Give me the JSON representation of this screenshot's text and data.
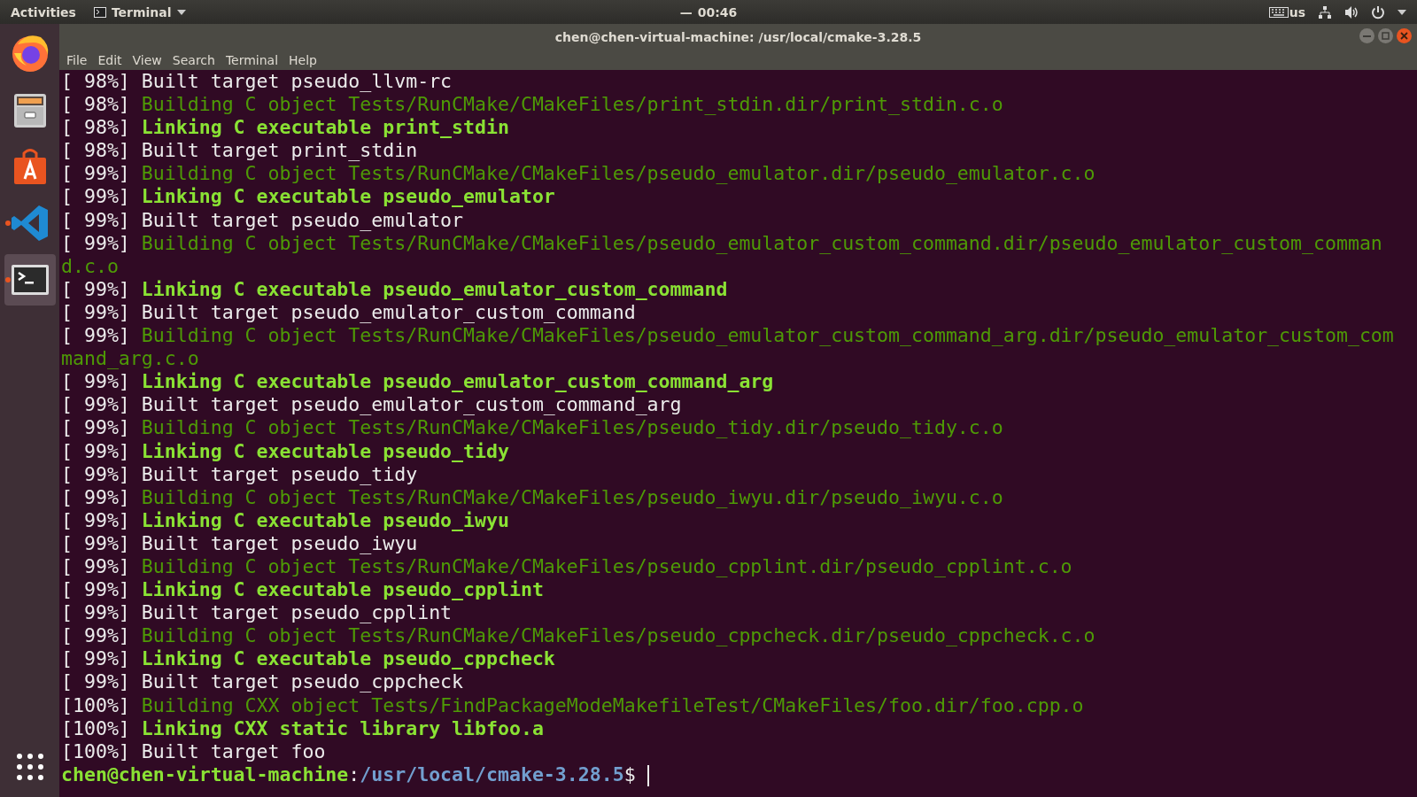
{
  "top_bar": {
    "activities": "Activities",
    "app_menu": "Terminal",
    "clock_indicator": "—",
    "clock": "00:46",
    "keyboard_layout": "us"
  },
  "dock": {
    "items": [
      {
        "kind": "firefox",
        "running": false,
        "selected": false
      },
      {
        "kind": "files",
        "running": false,
        "selected": false
      },
      {
        "kind": "software",
        "running": false,
        "selected": false
      },
      {
        "kind": "code",
        "running": true,
        "selected": false
      },
      {
        "kind": "terminal",
        "running": true,
        "selected": true
      }
    ]
  },
  "window": {
    "title": "chen@chen-virtual-machine: /usr/local/cmake-3.28.5"
  },
  "menu": [
    "File",
    "Edit",
    "View",
    "Search",
    "Terminal",
    "Help"
  ],
  "terminal": {
    "lines": [
      {
        "progress": "[ 98%]",
        "kind": "built",
        "message": "Built target pseudo_llvm-rc"
      },
      {
        "progress": "[ 98%]",
        "kind": "building",
        "message": "Building C object Tests/RunCMake/CMakeFiles/print_stdin.dir/print_stdin.c.o"
      },
      {
        "progress": "[ 98%]",
        "kind": "linking",
        "message": "Linking C executable print_stdin"
      },
      {
        "progress": "[ 98%]",
        "kind": "built",
        "message": "Built target print_stdin"
      },
      {
        "progress": "[ 99%]",
        "kind": "building",
        "message": "Building C object Tests/RunCMake/CMakeFiles/pseudo_emulator.dir/pseudo_emulator.c.o"
      },
      {
        "progress": "[ 99%]",
        "kind": "linking",
        "message": "Linking C executable pseudo_emulator"
      },
      {
        "progress": "[ 99%]",
        "kind": "built",
        "message": "Built target pseudo_emulator"
      },
      {
        "progress": "[ 99%]",
        "kind": "building",
        "message": "Building C object Tests/RunCMake/CMakeFiles/pseudo_emulator_custom_command.dir/pseudo_emulator_custom_command.c.o"
      },
      {
        "progress": "[ 99%]",
        "kind": "linking",
        "message": "Linking C executable pseudo_emulator_custom_command"
      },
      {
        "progress": "[ 99%]",
        "kind": "built",
        "message": "Built target pseudo_emulator_custom_command"
      },
      {
        "progress": "[ 99%]",
        "kind": "building",
        "message": "Building C object Tests/RunCMake/CMakeFiles/pseudo_emulator_custom_command_arg.dir/pseudo_emulator_custom_command_arg.c.o"
      },
      {
        "progress": "[ 99%]",
        "kind": "linking",
        "message": "Linking C executable pseudo_emulator_custom_command_arg"
      },
      {
        "progress": "[ 99%]",
        "kind": "built",
        "message": "Built target pseudo_emulator_custom_command_arg"
      },
      {
        "progress": "[ 99%]",
        "kind": "building",
        "message": "Building C object Tests/RunCMake/CMakeFiles/pseudo_tidy.dir/pseudo_tidy.c.o"
      },
      {
        "progress": "[ 99%]",
        "kind": "linking",
        "message": "Linking C executable pseudo_tidy"
      },
      {
        "progress": "[ 99%]",
        "kind": "built",
        "message": "Built target pseudo_tidy"
      },
      {
        "progress": "[ 99%]",
        "kind": "building",
        "message": "Building C object Tests/RunCMake/CMakeFiles/pseudo_iwyu.dir/pseudo_iwyu.c.o"
      },
      {
        "progress": "[ 99%]",
        "kind": "linking",
        "message": "Linking C executable pseudo_iwyu"
      },
      {
        "progress": "[ 99%]",
        "kind": "built",
        "message": "Built target pseudo_iwyu"
      },
      {
        "progress": "[ 99%]",
        "kind": "building",
        "message": "Building C object Tests/RunCMake/CMakeFiles/pseudo_cpplint.dir/pseudo_cpplint.c.o"
      },
      {
        "progress": "[ 99%]",
        "kind": "linking",
        "message": "Linking C executable pseudo_cpplint"
      },
      {
        "progress": "[ 99%]",
        "kind": "built",
        "message": "Built target pseudo_cpplint"
      },
      {
        "progress": "[ 99%]",
        "kind": "building",
        "message": "Building C object Tests/RunCMake/CMakeFiles/pseudo_cppcheck.dir/pseudo_cppcheck.c.o"
      },
      {
        "progress": "[ 99%]",
        "kind": "linking",
        "message": "Linking C executable pseudo_cppcheck"
      },
      {
        "progress": "[ 99%]",
        "kind": "built",
        "message": "Built target pseudo_cppcheck"
      },
      {
        "progress": "[100%]",
        "kind": "building",
        "message": "Building CXX object Tests/FindPackageModeMakefileTest/CMakeFiles/foo.dir/foo.cpp.o"
      },
      {
        "progress": "[100%]",
        "kind": "linking",
        "message": "Linking CXX static library libfoo.a"
      },
      {
        "progress": "[100%]",
        "kind": "built",
        "message": "Built target foo"
      }
    ],
    "prompt": {
      "user_host": "chen@chen-virtual-machine",
      "separator": ":",
      "path": "/usr/local/cmake-3.28.5",
      "symbol": "$"
    }
  }
}
